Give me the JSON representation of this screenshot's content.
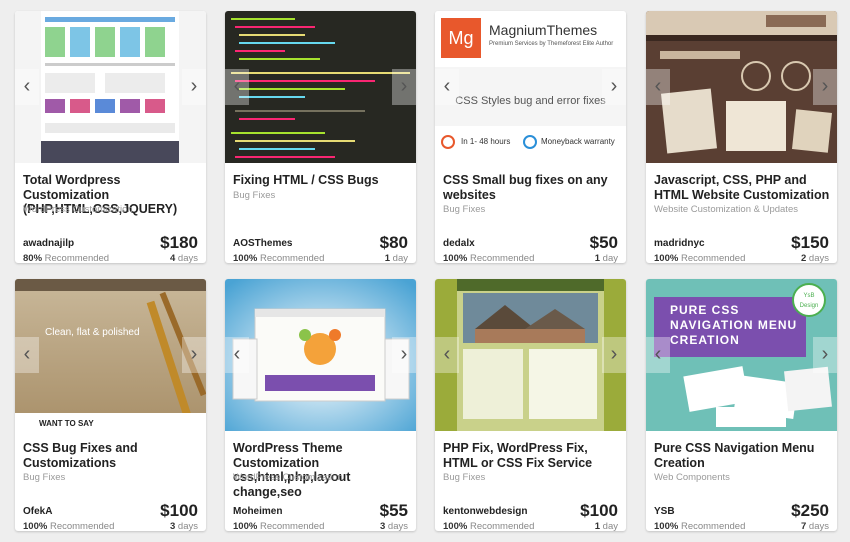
{
  "cards": [
    {
      "title": "Total Wordpress Customization (PHP,HTML,CSS,JQUERY)",
      "category": "WordPress Customization",
      "seller": "awadnajilp",
      "recommended_pct": "80%",
      "recommended_label": "Recommended",
      "price": "$180",
      "days_num": "4",
      "days_label": "days"
    },
    {
      "title": "Fixing HTML / CSS Bugs",
      "category": "Bug Fixes",
      "seller": "AOSThemes",
      "recommended_pct": "100%",
      "recommended_label": "Recommended",
      "price": "$80",
      "days_num": "1",
      "days_label": "day"
    },
    {
      "title": "CSS Small bug fixes on any websites",
      "category": "Bug Fixes",
      "seller": "dedalx",
      "recommended_pct": "100%",
      "recommended_label": "Recommended",
      "price": "$50",
      "days_num": "1",
      "days_label": "day"
    },
    {
      "title": "Javascript, CSS, PHP and HTML Website Customization",
      "category": "Website Customization & Updates",
      "seller": "madridnyc",
      "recommended_pct": "100%",
      "recommended_label": "Recommended",
      "price": "$150",
      "days_num": "2",
      "days_label": "days"
    },
    {
      "title": "CSS Bug Fixes and Customizations",
      "category": "Bug Fixes",
      "seller": "OfekA",
      "recommended_pct": "100%",
      "recommended_label": "Recommended",
      "price": "$100",
      "days_num": "3",
      "days_label": "days"
    },
    {
      "title": "WordPress Theme Customization css,html,php,layout change,seo",
      "category": "WordPress Customization",
      "seller": "Moheimen",
      "recommended_pct": "100%",
      "recommended_label": "Recommended",
      "price": "$55",
      "days_num": "3",
      "days_label": "days"
    },
    {
      "title": "PHP Fix, WordPress Fix, HTML or CSS Fix Service",
      "category": "Bug Fixes",
      "seller": "kentonwebdesign",
      "recommended_pct": "100%",
      "recommended_label": "Recommended",
      "price": "$100",
      "days_num": "1",
      "days_label": "day"
    },
    {
      "title": "Pure CSS Navigation Menu Creation",
      "category": "Web Components",
      "seller": "YSB",
      "recommended_pct": "100%",
      "recommended_label": "Recommended",
      "price": "$250",
      "days_num": "7",
      "days_label": "days"
    }
  ],
  "thumbs": {
    "magnium_logo": "Mg",
    "magnium_brand": "MagniumThemes",
    "magnium_sub": "Premium Services by Themeforest Elite Author",
    "magnium_tagline": "CSS Styles bug and error fixes",
    "magnium_hours": "In 1- 48 hours",
    "magnium_warranty": "Moneyback warranty",
    "ofeka_heading": "Clean, flat & polished",
    "ofeka_band": "WANT TO SAY",
    "ysb_heading": "PURE CSS NAVIGATION MENU CREATION",
    "ysb_badge": "YsB Design"
  },
  "colors": {
    "page_bg": "#eeeeee",
    "card_bg": "#ffffff",
    "magnium_orange": "#e8582c",
    "ysb_purple": "#7b4fae",
    "teal_bg": "#6fc0b7"
  }
}
